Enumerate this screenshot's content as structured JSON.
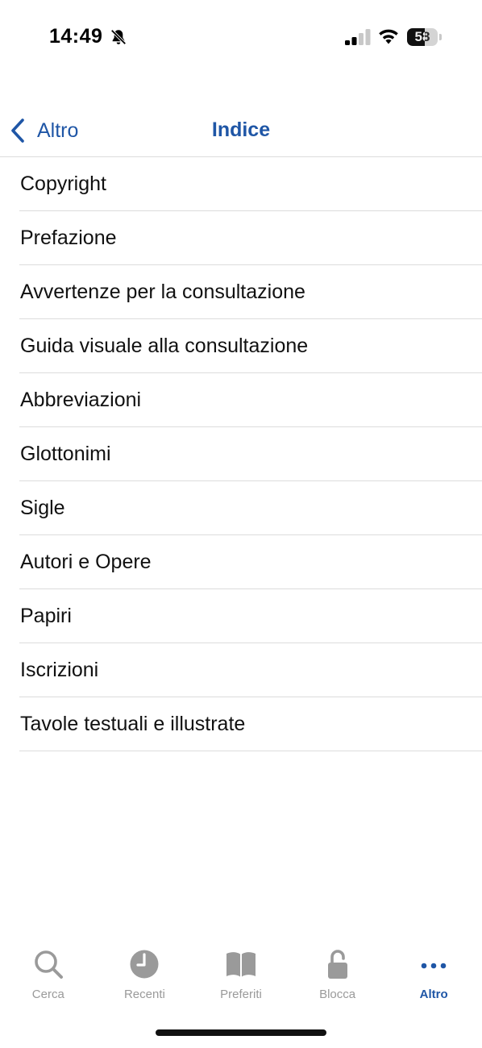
{
  "status_bar": {
    "time": "14:49",
    "battery_level": "58",
    "battery_fraction": 0.58
  },
  "nav": {
    "back_label": "Altro",
    "title": "Indice"
  },
  "index_items": [
    "Copyright",
    "Prefazione",
    "Avvertenze per la consultazione",
    "Guida visuale alla consultazione",
    "Abbreviazioni",
    "Glottonimi",
    "Sigle",
    "Autori e Opere",
    "Papiri",
    "Iscrizioni",
    "Tavole testuali e illustrate"
  ],
  "tabs": [
    {
      "label": "Cerca",
      "icon": "magnifier-icon"
    },
    {
      "label": "Recenti",
      "icon": "clock-icon"
    },
    {
      "label": "Preferiti",
      "icon": "book-icon"
    },
    {
      "label": "Blocca",
      "icon": "lock-icon"
    },
    {
      "label": "Altro",
      "icon": "ellipsis-icon",
      "active": true
    }
  ],
  "colors": {
    "accent": "#1f56a6",
    "inactive": "#9a9a9a",
    "separator": "#dcdcdc"
  }
}
